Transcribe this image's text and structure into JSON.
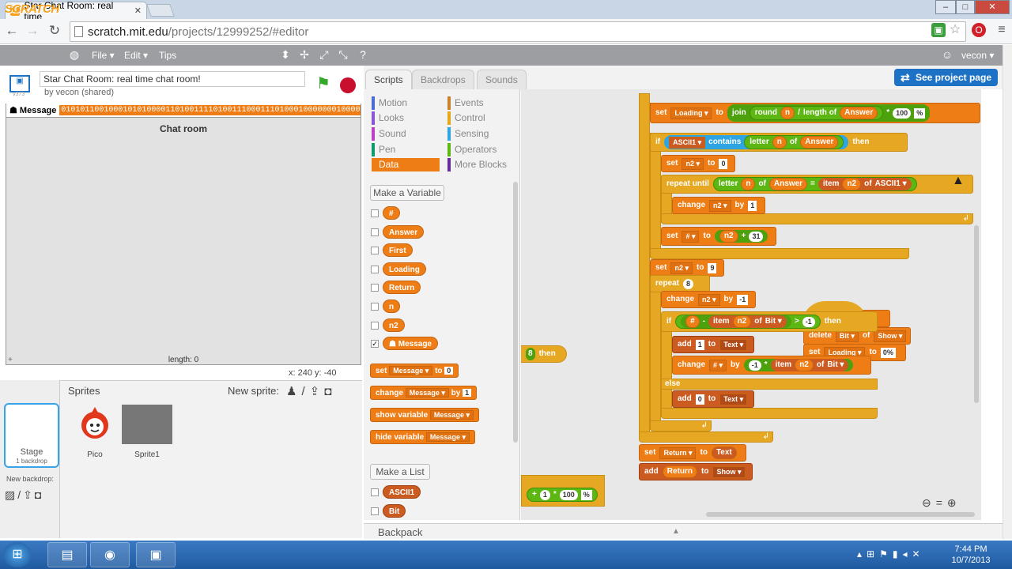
{
  "browser": {
    "tab_title": "Star Chat Room: real time",
    "url_host": "scratch.mit.edu",
    "url_path": "/projects/12999252/#editor",
    "new_tab_label": ""
  },
  "menubar": {
    "logo": "SCRATCH",
    "file": "File ▾",
    "edit": "Edit ▾",
    "tips": "Tips",
    "user": "vecon ▾"
  },
  "stage": {
    "project_title": "Star Chat Room: real time chat room!",
    "owner": "by vecon (shared)",
    "version": "v373",
    "watcher_label": "Message",
    "watcher_value": "0101011001000101010000110100111101001110001110100010000000100000000",
    "list_title": "Chat room",
    "list_length": "length: 0",
    "list_add": "+",
    "coords": "x: 240   y: -40"
  },
  "sprites": {
    "title": "Sprites",
    "new_sprite": "New sprite:",
    "stage_label": "Stage",
    "stage_sub": "1 backdrop",
    "new_backdrop": "New backdrop:",
    "items": [
      {
        "name": "Pico"
      },
      {
        "name": "Sprite1"
      }
    ]
  },
  "tabs": {
    "scripts": "Scripts",
    "backdrops": "Backdrops",
    "sounds": "Sounds",
    "see_project": "See project page"
  },
  "categories": {
    "left": [
      "Motion",
      "Looks",
      "Sound",
      "Pen",
      "Data"
    ],
    "right": [
      "Events",
      "Control",
      "Sensing",
      "Operators",
      "More Blocks"
    ],
    "colors": {
      "Motion": "#4a6cd4",
      "Looks": "#8a55d7",
      "Sound": "#bb42c3",
      "Pen": "#0e9a6c",
      "Data": "#ee7d16",
      "Events": "#c88330",
      "Control": "#e1a91a",
      "Sensing": "#2ca5e2",
      "Operators": "#5cb712",
      "More Blocks": "#632d99"
    }
  },
  "palette": {
    "make_variable": "Make a Variable",
    "variables": [
      "#",
      "Answer",
      "First",
      "Loading",
      "Return",
      "n",
      "n2",
      "Message"
    ],
    "checked_variable": "Message",
    "blocks": {
      "set": "set",
      "set_var": "Message ▾",
      "set_to": "to",
      "set_val": "0",
      "change": "change",
      "change_var": "Message ▾",
      "change_by": "by",
      "change_val": "1",
      "show_variable": "show variable",
      "show_var": "Message ▾",
      "hide_variable": "hide variable",
      "hide_var": "Message ▾"
    },
    "make_list": "Make a List",
    "lists": [
      "ASCII1",
      "Bit"
    ],
    "backpack": "Backpack"
  },
  "script": {
    "b1": {
      "set": "set",
      "var": "Loading ▾",
      "to": "to",
      "join": "join",
      "round": "round",
      "n": "n",
      "div": "/",
      "length_of": "length of",
      "answer": "Answer",
      "mult": "*",
      "hundred": "100",
      "pct": "%"
    },
    "b2": {
      "if": "if",
      "list": "ASCII1 ▾",
      "contains": "contains",
      "letter": "letter",
      "n": "n",
      "of": "of",
      "answer": "Answer",
      "then": "then"
    },
    "b3": {
      "set": "set",
      "var": "n2 ▾",
      "to": "to",
      "val": "0"
    },
    "b4": {
      "repeat_until": "repeat until",
      "letter": "letter",
      "n": "n",
      "of": "of",
      "answer": "Answer",
      "eq": "=",
      "item": "item",
      "n2": "n2",
      "of2": "of",
      "list": "ASCII1 ▾"
    },
    "b5": {
      "change": "change",
      "var": "n2 ▾",
      "by": "by",
      "val": "1"
    },
    "b6": {
      "set": "set",
      "var": "# ▾",
      "to": "to",
      "n2": "n2",
      "plus": "+",
      "val": "31"
    },
    "b7": {
      "set": "set",
      "var": "n2 ▾",
      "to": "to",
      "val": "9"
    },
    "b8": {
      "repeat": "repeat",
      "val": "8"
    },
    "b9": {
      "change": "change",
      "var": "n2 ▾",
      "by": "by",
      "val": "-1"
    },
    "b10": {
      "if": "if",
      "hash": "#",
      "minus": "-",
      "item": "item",
      "n2": "n2",
      "of": "of",
      "list": "Bit ▾",
      "gt": ">",
      "val": "-1",
      "then": "then"
    },
    "b11": {
      "add": "add",
      "val": "1",
      "to": "to",
      "list": "Text ▾"
    },
    "b12": {
      "change": "change",
      "var": "# ▾",
      "by": "by",
      "neg": "-1",
      "mult": "*",
      "item": "item",
      "n2": "n2",
      "of": "of",
      "list": "Bit ▾"
    },
    "b13": {
      "else": "else"
    },
    "b14": {
      "add": "add",
      "val": "0",
      "to": "to",
      "list": "Text ▾"
    },
    "b15": {
      "set": "set",
      "var": "Return ▾",
      "to": "to",
      "text": "Text"
    },
    "b16": {
      "add": "add",
      "var": "Return",
      "to": "to",
      "list": "Show ▾"
    },
    "bg1": {
      "then": "then",
      "digit": "8"
    },
    "bg2": {
      "plus": "+",
      "one": "1",
      "mult": "*",
      "hundred": "100",
      "pct": "%"
    },
    "bg3": {
      "delete": "delete",
      "list": "Bit ▾",
      "of": "of",
      "show": "Show ▾",
      "set": "set",
      "loading": "Loading ▾",
      "to": "to",
      "pct": "0%",
      "d": "d"
    }
  },
  "taskbar": {
    "time": "7:44 PM",
    "date": "10/7/2013"
  }
}
